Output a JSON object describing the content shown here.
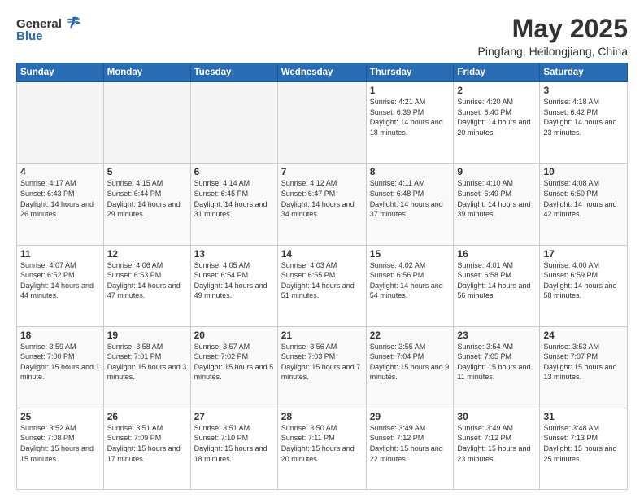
{
  "header": {
    "logo_general": "General",
    "logo_blue": "Blue",
    "month": "May 2025",
    "location": "Pingfang, Heilongjiang, China"
  },
  "weekdays": [
    "Sunday",
    "Monday",
    "Tuesday",
    "Wednesday",
    "Thursday",
    "Friday",
    "Saturday"
  ],
  "weeks": [
    [
      {
        "day": "",
        "empty": true
      },
      {
        "day": "",
        "empty": true
      },
      {
        "day": "",
        "empty": true
      },
      {
        "day": "",
        "empty": true
      },
      {
        "day": "1",
        "sunrise": "4:21 AM",
        "sunset": "6:39 PM",
        "daylight": "14 hours and 18 minutes."
      },
      {
        "day": "2",
        "sunrise": "4:20 AM",
        "sunset": "6:40 PM",
        "daylight": "14 hours and 20 minutes."
      },
      {
        "day": "3",
        "sunrise": "4:18 AM",
        "sunset": "6:42 PM",
        "daylight": "14 hours and 23 minutes."
      }
    ],
    [
      {
        "day": "4",
        "sunrise": "4:17 AM",
        "sunset": "6:43 PM",
        "daylight": "14 hours and 26 minutes."
      },
      {
        "day": "5",
        "sunrise": "4:15 AM",
        "sunset": "6:44 PM",
        "daylight": "14 hours and 29 minutes."
      },
      {
        "day": "6",
        "sunrise": "4:14 AM",
        "sunset": "6:45 PM",
        "daylight": "14 hours and 31 minutes."
      },
      {
        "day": "7",
        "sunrise": "4:12 AM",
        "sunset": "6:47 PM",
        "daylight": "14 hours and 34 minutes."
      },
      {
        "day": "8",
        "sunrise": "4:11 AM",
        "sunset": "6:48 PM",
        "daylight": "14 hours and 37 minutes."
      },
      {
        "day": "9",
        "sunrise": "4:10 AM",
        "sunset": "6:49 PM",
        "daylight": "14 hours and 39 minutes."
      },
      {
        "day": "10",
        "sunrise": "4:08 AM",
        "sunset": "6:50 PM",
        "daylight": "14 hours and 42 minutes."
      }
    ],
    [
      {
        "day": "11",
        "sunrise": "4:07 AM",
        "sunset": "6:52 PM",
        "daylight": "14 hours and 44 minutes."
      },
      {
        "day": "12",
        "sunrise": "4:06 AM",
        "sunset": "6:53 PM",
        "daylight": "14 hours and 47 minutes."
      },
      {
        "day": "13",
        "sunrise": "4:05 AM",
        "sunset": "6:54 PM",
        "daylight": "14 hours and 49 minutes."
      },
      {
        "day": "14",
        "sunrise": "4:03 AM",
        "sunset": "6:55 PM",
        "daylight": "14 hours and 51 minutes."
      },
      {
        "day": "15",
        "sunrise": "4:02 AM",
        "sunset": "6:56 PM",
        "daylight": "14 hours and 54 minutes."
      },
      {
        "day": "16",
        "sunrise": "4:01 AM",
        "sunset": "6:58 PM",
        "daylight": "14 hours and 56 minutes."
      },
      {
        "day": "17",
        "sunrise": "4:00 AM",
        "sunset": "6:59 PM",
        "daylight": "14 hours and 58 minutes."
      }
    ],
    [
      {
        "day": "18",
        "sunrise": "3:59 AM",
        "sunset": "7:00 PM",
        "daylight": "15 hours and 1 minute."
      },
      {
        "day": "19",
        "sunrise": "3:58 AM",
        "sunset": "7:01 PM",
        "daylight": "15 hours and 3 minutes."
      },
      {
        "day": "20",
        "sunrise": "3:57 AM",
        "sunset": "7:02 PM",
        "daylight": "15 hours and 5 minutes."
      },
      {
        "day": "21",
        "sunrise": "3:56 AM",
        "sunset": "7:03 PM",
        "daylight": "15 hours and 7 minutes."
      },
      {
        "day": "22",
        "sunrise": "3:55 AM",
        "sunset": "7:04 PM",
        "daylight": "15 hours and 9 minutes."
      },
      {
        "day": "23",
        "sunrise": "3:54 AM",
        "sunset": "7:05 PM",
        "daylight": "15 hours and 11 minutes."
      },
      {
        "day": "24",
        "sunrise": "3:53 AM",
        "sunset": "7:07 PM",
        "daylight": "15 hours and 13 minutes."
      }
    ],
    [
      {
        "day": "25",
        "sunrise": "3:52 AM",
        "sunset": "7:08 PM",
        "daylight": "15 hours and 15 minutes."
      },
      {
        "day": "26",
        "sunrise": "3:51 AM",
        "sunset": "7:09 PM",
        "daylight": "15 hours and 17 minutes."
      },
      {
        "day": "27",
        "sunrise": "3:51 AM",
        "sunset": "7:10 PM",
        "daylight": "15 hours and 18 minutes."
      },
      {
        "day": "28",
        "sunrise": "3:50 AM",
        "sunset": "7:11 PM",
        "daylight": "15 hours and 20 minutes."
      },
      {
        "day": "29",
        "sunrise": "3:49 AM",
        "sunset": "7:12 PM",
        "daylight": "15 hours and 22 minutes."
      },
      {
        "day": "30",
        "sunrise": "3:49 AM",
        "sunset": "7:12 PM",
        "daylight": "15 hours and 23 minutes."
      },
      {
        "day": "31",
        "sunrise": "3:48 AM",
        "sunset": "7:13 PM",
        "daylight": "15 hours and 25 minutes."
      }
    ]
  ]
}
